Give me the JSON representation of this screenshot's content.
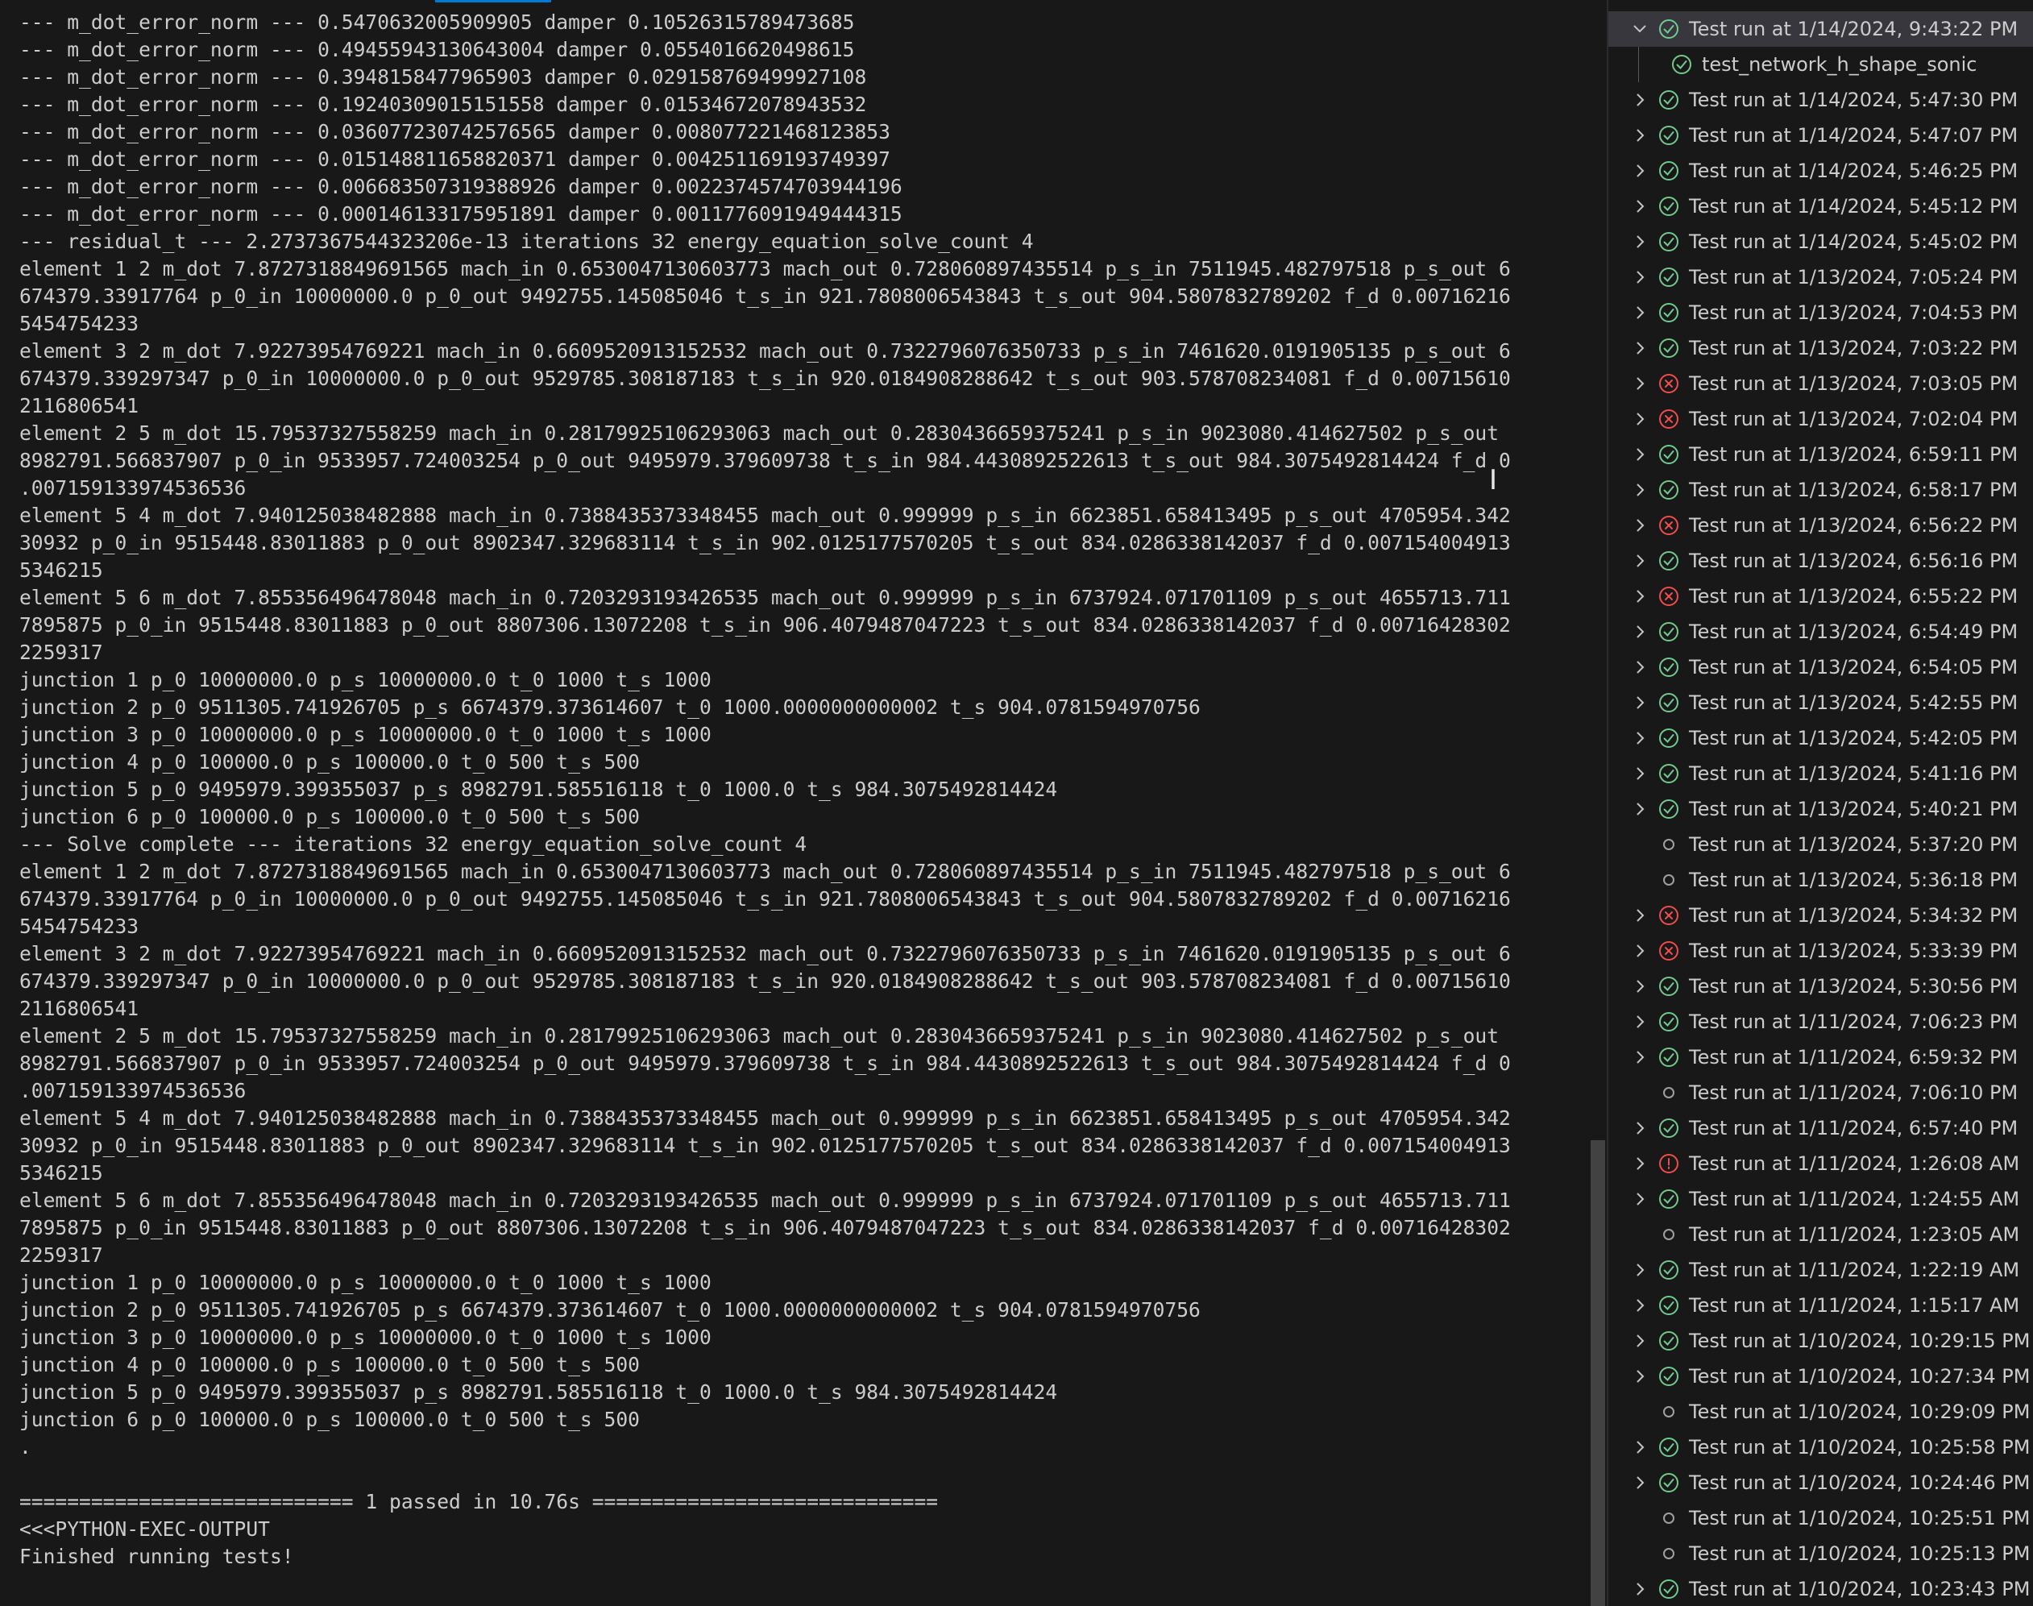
{
  "terminal": {
    "lines": [
      "--- m_dot_error_norm --- 0.5470632005909905 damper 0.10526315789473685",
      "--- m_dot_error_norm --- 0.49455943130643004 damper 0.0554016620498615",
      "--- m_dot_error_norm --- 0.3948158477965903 damper 0.029158769499927108",
      "--- m_dot_error_norm --- 0.19240309015151558 damper 0.01534672078943532",
      "--- m_dot_error_norm --- 0.036077230742576565 damper 0.008077221468123853",
      "--- m_dot_error_norm --- 0.015148811658820371 damper 0.004251169193749397",
      "--- m_dot_error_norm --- 0.006683507319388926 damper 0.0022374574703944196",
      "--- m_dot_error_norm --- 0.000146133175951891 damper 0.0011776091949444315",
      "--- residual_t --- 2.2737367544323206e-13 iterations 32 energy_equation_solve_count 4",
      "element 1 2 m_dot 7.8727318849691565 mach_in 0.6530047130603773 mach_out 0.728060897435514 p_s_in 7511945.482797518 p_s_out 6",
      "674379.33917764 p_0_in 10000000.0 p_0_out 9492755.145085046 t_s_in 921.7808006543843 t_s_out 904.5807832789202 f_d 0.00716216",
      "5454754233",
      "element 3 2 m_dot 7.92273954769221 mach_in 0.6609520913152532 mach_out 0.7322796076350733 p_s_in 7461620.0191905135 p_s_out 6",
      "674379.339297347 p_0_in 10000000.0 p_0_out 9529785.308187183 t_s_in 920.0184908288642 t_s_out 903.578708234081 f_d 0.00715610",
      "2116806541",
      "element 2 5 m_dot 15.79537327558259 mach_in 0.28179925106293063 mach_out 0.2830436659375241 p_s_in 9023080.414627502 p_s_out",
      "8982791.566837907 p_0_in 9533957.724003254 p_0_out 9495979.379609738 t_s_in 984.4430892522613 t_s_out 984.3075492814424 f_d 0",
      ".007159133974536536",
      "element 5 4 m_dot 7.940125038482888 mach_in 0.7388435373348455 mach_out 0.999999 p_s_in 6623851.658413495 p_s_out 4705954.342",
      "30932 p_0_in 9515448.83011883 p_0_out 8902347.329683114 t_s_in 902.0125177570205 t_s_out 834.0286338142037 f_d 0.007154004913",
      "5346215",
      "element 5 6 m_dot 7.855356496478048 mach_in 0.7203293193426535 mach_out 0.999999 p_s_in 6737924.071701109 p_s_out 4655713.711",
      "7895875 p_0_in 9515448.83011883 p_0_out 8807306.13072208 t_s_in 906.4079487047223 t_s_out 834.0286338142037 f_d 0.00716428302",
      "2259317",
      "junction 1 p_0 10000000.0 p_s 10000000.0 t_0 1000 t_s 1000",
      "junction 2 p_0 9511305.741926705 p_s 6674379.373614607 t_0 1000.0000000000002 t_s 904.0781594970756",
      "junction 3 p_0 10000000.0 p_s 10000000.0 t_0 1000 t_s 1000",
      "junction 4 p_0 100000.0 p_s 100000.0 t_0 500 t_s 500",
      "junction 5 p_0 9495979.399355037 p_s 8982791.585516118 t_0 1000.0 t_s 984.3075492814424",
      "junction 6 p_0 100000.0 p_s 100000.0 t_0 500 t_s 500",
      "--- Solve complete --- iterations 32 energy_equation_solve_count 4",
      "element 1 2 m_dot 7.8727318849691565 mach_in 0.6530047130603773 mach_out 0.728060897435514 p_s_in 7511945.482797518 p_s_out 6",
      "674379.33917764 p_0_in 10000000.0 p_0_out 9492755.145085046 t_s_in 921.7808006543843 t_s_out 904.5807832789202 f_d 0.00716216",
      "5454754233",
      "element 3 2 m_dot 7.92273954769221 mach_in 0.6609520913152532 mach_out 0.7322796076350733 p_s_in 7461620.0191905135 p_s_out 6",
      "674379.339297347 p_0_in 10000000.0 p_0_out 9529785.308187183 t_s_in 920.0184908288642 t_s_out 903.578708234081 f_d 0.00715610",
      "2116806541",
      "element 2 5 m_dot 15.79537327558259 mach_in 0.28179925106293063 mach_out 0.2830436659375241 p_s_in 9023080.414627502 p_s_out",
      "8982791.566837907 p_0_in 9533957.724003254 p_0_out 9495979.379609738 t_s_in 984.4430892522613 t_s_out 984.3075492814424 f_d 0",
      ".007159133974536536",
      "element 5 4 m_dot 7.940125038482888 mach_in 0.7388435373348455 mach_out 0.999999 p_s_in 6623851.658413495 p_s_out 4705954.342",
      "30932 p_0_in 9515448.83011883 p_0_out 8902347.329683114 t_s_in 902.0125177570205 t_s_out 834.0286338142037 f_d 0.007154004913",
      "5346215",
      "element 5 6 m_dot 7.855356496478048 mach_in 0.7203293193426535 mach_out 0.999999 p_s_in 6737924.071701109 p_s_out 4655713.711",
      "7895875 p_0_in 9515448.83011883 p_0_out 8807306.13072208 t_s_in 906.4079487047223 t_s_out 834.0286338142037 f_d 0.00716428302",
      "2259317",
      "junction 1 p_0 10000000.0 p_s 10000000.0 t_0 1000 t_s 1000",
      "junction 2 p_0 9511305.741926705 p_s 6674379.373614607 t_0 1000.0000000000002 t_s 904.0781594970756",
      "junction 3 p_0 10000000.0 p_s 10000000.0 t_0 1000 t_s 1000",
      "junction 4 p_0 100000.0 p_s 100000.0 t_0 500 t_s 500",
      "junction 5 p_0 9495979.399355037 p_s 8982791.585516118 t_0 1000.0 t_s 984.3075492814424",
      "junction 6 p_0 100000.0 p_s 100000.0 t_0 500 t_s 500",
      ".",
      "",
      "============================ 1 passed in 10.76s =============================",
      "<<<PYTHON-EXEC-OUTPUT",
      "Finished running tests!"
    ]
  },
  "test_explorer": {
    "colors": {
      "passed": "#73c991",
      "failed": "#f14c4c",
      "skipped": "#a0a0a0"
    },
    "items": [
      {
        "label": "Test run at 1/14/2024, 9:43:22 PM",
        "status": "passed",
        "expanded": true,
        "selected": true
      },
      {
        "label": "test_network_h_shape_sonic",
        "status": "passed",
        "child": true
      },
      {
        "label": "Test run at 1/14/2024, 5:47:30 PM",
        "status": "passed"
      },
      {
        "label": "Test run at 1/14/2024, 5:47:07 PM",
        "status": "passed"
      },
      {
        "label": "Test run at 1/14/2024, 5:46:25 PM",
        "status": "passed"
      },
      {
        "label": "Test run at 1/14/2024, 5:45:12 PM",
        "status": "passed"
      },
      {
        "label": "Test run at 1/14/2024, 5:45:02 PM",
        "status": "passed"
      },
      {
        "label": "Test run at 1/13/2024, 7:05:24 PM",
        "status": "passed"
      },
      {
        "label": "Test run at 1/13/2024, 7:04:53 PM",
        "status": "passed"
      },
      {
        "label": "Test run at 1/13/2024, 7:03:22 PM",
        "status": "passed"
      },
      {
        "label": "Test run at 1/13/2024, 7:03:05 PM",
        "status": "failed"
      },
      {
        "label": "Test run at 1/13/2024, 7:02:04 PM",
        "status": "failed"
      },
      {
        "label": "Test run at 1/13/2024, 6:59:11 PM",
        "status": "passed"
      },
      {
        "label": "Test run at 1/13/2024, 6:58:17 PM",
        "status": "passed"
      },
      {
        "label": "Test run at 1/13/2024, 6:56:22 PM",
        "status": "failed"
      },
      {
        "label": "Test run at 1/13/2024, 6:56:16 PM",
        "status": "passed"
      },
      {
        "label": "Test run at 1/13/2024, 6:55:22 PM",
        "status": "failed"
      },
      {
        "label": "Test run at 1/13/2024, 6:54:49 PM",
        "status": "passed"
      },
      {
        "label": "Test run at 1/13/2024, 6:54:05 PM",
        "status": "passed"
      },
      {
        "label": "Test run at 1/13/2024, 5:42:55 PM",
        "status": "passed"
      },
      {
        "label": "Test run at 1/13/2024, 5:42:05 PM",
        "status": "passed"
      },
      {
        "label": "Test run at 1/13/2024, 5:41:16 PM",
        "status": "passed"
      },
      {
        "label": "Test run at 1/13/2024, 5:40:21 PM",
        "status": "passed"
      },
      {
        "label": "Test run at 1/13/2024, 5:37:20 PM",
        "status": "skipped",
        "leaf": true
      },
      {
        "label": "Test run at 1/13/2024, 5:36:18 PM",
        "status": "skipped",
        "leaf": true
      },
      {
        "label": "Test run at 1/13/2024, 5:34:32 PM",
        "status": "failed"
      },
      {
        "label": "Test run at 1/13/2024, 5:33:39 PM",
        "status": "failed"
      },
      {
        "label": "Test run at 1/13/2024, 5:30:56 PM",
        "status": "passed"
      },
      {
        "label": "Test run at 1/11/2024, 7:06:23 PM",
        "status": "passed"
      },
      {
        "label": "Test run at 1/11/2024, 6:59:32 PM",
        "status": "passed"
      },
      {
        "label": "Test run at 1/11/2024, 7:06:10 PM",
        "status": "skipped",
        "leaf": true
      },
      {
        "label": "Test run at 1/11/2024, 6:57:40 PM",
        "status": "passed"
      },
      {
        "label": "Test run at 1/11/2024, 1:26:08 AM",
        "status": "errored"
      },
      {
        "label": "Test run at 1/11/2024, 1:24:55 AM",
        "status": "passed"
      },
      {
        "label": "Test run at 1/11/2024, 1:23:05 AM",
        "status": "skipped",
        "leaf": true
      },
      {
        "label": "Test run at 1/11/2024, 1:22:19 AM",
        "status": "passed"
      },
      {
        "label": "Test run at 1/11/2024, 1:15:17 AM",
        "status": "passed"
      },
      {
        "label": "Test run at 1/10/2024, 10:29:15 PM",
        "status": "passed"
      },
      {
        "label": "Test run at 1/10/2024, 10:27:34 PM",
        "status": "passed"
      },
      {
        "label": "Test run at 1/10/2024, 10:29:09 PM",
        "status": "skipped",
        "leaf": true
      },
      {
        "label": "Test run at 1/10/2024, 10:25:58 PM",
        "status": "passed"
      },
      {
        "label": "Test run at 1/10/2024, 10:24:46 PM",
        "status": "passed"
      },
      {
        "label": "Test run at 1/10/2024, 10:25:51 PM",
        "status": "skipped",
        "leaf": true
      },
      {
        "label": "Test run at 1/10/2024, 10:25:13 PM",
        "status": "skipped",
        "leaf": true
      },
      {
        "label": "Test run at 1/10/2024, 10:23:43 PM",
        "status": "passed"
      }
    ]
  }
}
